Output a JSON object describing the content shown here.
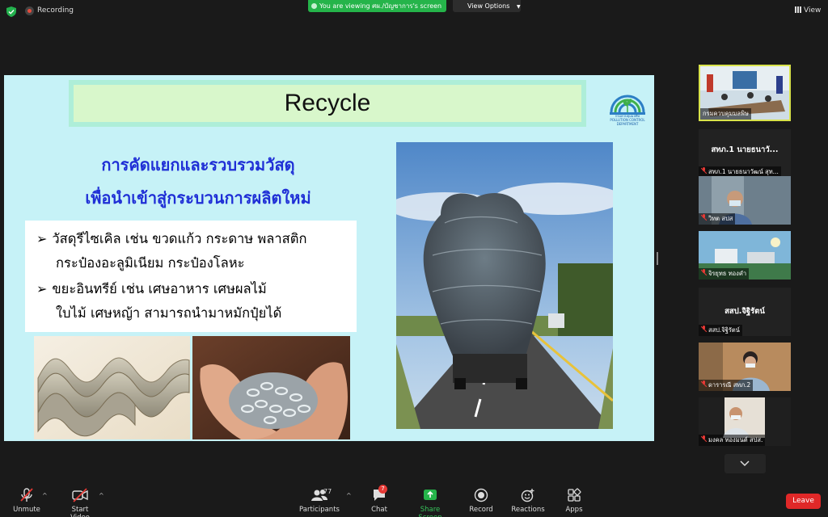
{
  "top_bar": {
    "recording_label": "Recording",
    "viewing_text": "You are viewing ศผ./บัญชาการ's screen",
    "view_options_label": "View Options",
    "view_label": "View"
  },
  "slide": {
    "title": "Recycle",
    "logo_text": "กรมควบคุมมลพิษ POLLUTION CONTROL DEPARTMENT",
    "heading_line1": "การคัดแยกและรวบรวมวัสดุ",
    "heading_line2": "เพื่อนำเข้าสู่กระบวนการผลิตใหม่",
    "bullet1_line1": "วัสดุรีไซเคิล เช่น ขวดแก้ว กระดาษ พลาสติก",
    "bullet1_line2": "กระป๋องอะลูมิเนียม กระป๋องโลหะ",
    "bullet2_line1": "ขยะอินทรีย์ เช่น เศษอาหาร เศษผลไม้",
    "bullet2_line2": "ใบไม้ เศษหญ้า สามารถนำมาหมักปุ๋ยได้",
    "arrow_glyph": "➢"
  },
  "participants": [
    {
      "name": "กรมควบคุมมลพิษ",
      "type": "video"
    },
    {
      "name": "สทภ.1 นายธนาวั...",
      "label": "สทภ.1 นายธนาวัฒน์ สุท...",
      "type": "name-only"
    },
    {
      "name": "วิทต สปส",
      "type": "video"
    },
    {
      "name": "จิรยุทธ ทองคำ",
      "type": "video"
    },
    {
      "name": "สสป.จิฐิรัตน์",
      "label": "สสป.จิฐิรัตน์",
      "type": "name-only"
    },
    {
      "name": "ดารารณี สทภ.2",
      "type": "video"
    },
    {
      "name": "มงคล ทองมนต์ สปส.",
      "type": "video"
    }
  ],
  "toolbar": {
    "unmute_label": "Unmute",
    "start_video_label": "Start Video",
    "participants_label": "Participants",
    "participants_count": "77",
    "chat_label": "Chat",
    "chat_badge": "7",
    "share_screen_label": "Share Screen",
    "record_label": "Record",
    "reactions_label": "Reactions",
    "apps_label": "Apps",
    "leave_label": "Leave"
  },
  "colors": {
    "accent_green": "#25b44a",
    "leave_red": "#e02828",
    "heading_blue": "#1f2fd6",
    "active_speaker_border": "#d8e24a"
  }
}
